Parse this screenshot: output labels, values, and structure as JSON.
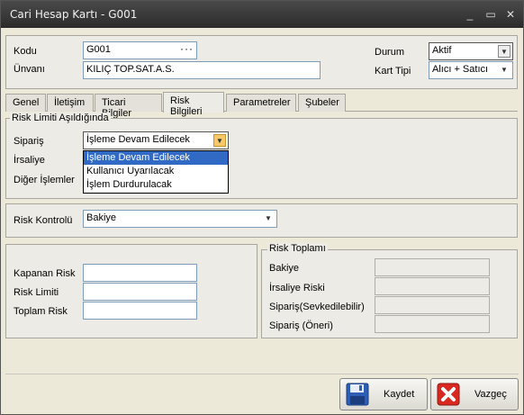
{
  "window": {
    "title": "Cari Hesap Kartı - G001"
  },
  "header": {
    "kodu_label": "Kodu",
    "kodu_value": "G001",
    "unvani_label": "Ünvanı",
    "unvani_value": "KILIÇ TOP.SAT.A.S.",
    "durum_label": "Durum",
    "durum_value": "Aktif",
    "kart_tipi_label": "Kart Tipi",
    "kart_tipi_value": "Alıcı + Satıcı"
  },
  "tabs": [
    {
      "label": "Genel"
    },
    {
      "label": "İletişim"
    },
    {
      "label": "Ticari Bilgiler"
    },
    {
      "label": "Risk Bilgileri"
    },
    {
      "label": "Parametreler"
    },
    {
      "label": "Şubeler"
    }
  ],
  "risk_limit_group": {
    "title": "Risk Limiti Aşıldığında",
    "siparis_label": "Sipariş",
    "siparis_value": "İşleme Devam Edilecek",
    "irsaliye_label": "İrsaliye",
    "diger_label": "Diğer İşlemler",
    "dropdown_options": [
      "İşleme Devam Edilecek",
      "Kullanıcı Uyarılacak",
      "İşlem Durdurulacak"
    ]
  },
  "risk_kontrol": {
    "label": "Risk Kontrolü",
    "value": "Bakiye"
  },
  "risk_limits": {
    "kapanan_label": "Kapanan Risk",
    "kapanan_value": "",
    "limit_label": "Risk Limiti",
    "limit_value": "",
    "toplam_label": "Toplam Risk",
    "toplam_value": ""
  },
  "risk_toplami": {
    "title": "Risk Toplamı",
    "bakiye_label": "Bakiye",
    "irsaliye_label": "İrsaliye Riski",
    "sevk_label": "Sipariş(Sevkedilebilir)",
    "oneri_label": "Sipariş (Öneri)"
  },
  "buttons": {
    "save_label": "Kaydet",
    "cancel_label": "Vazgeç"
  },
  "colors": {
    "selection": "#316ac5",
    "titlebar": "#333333"
  }
}
